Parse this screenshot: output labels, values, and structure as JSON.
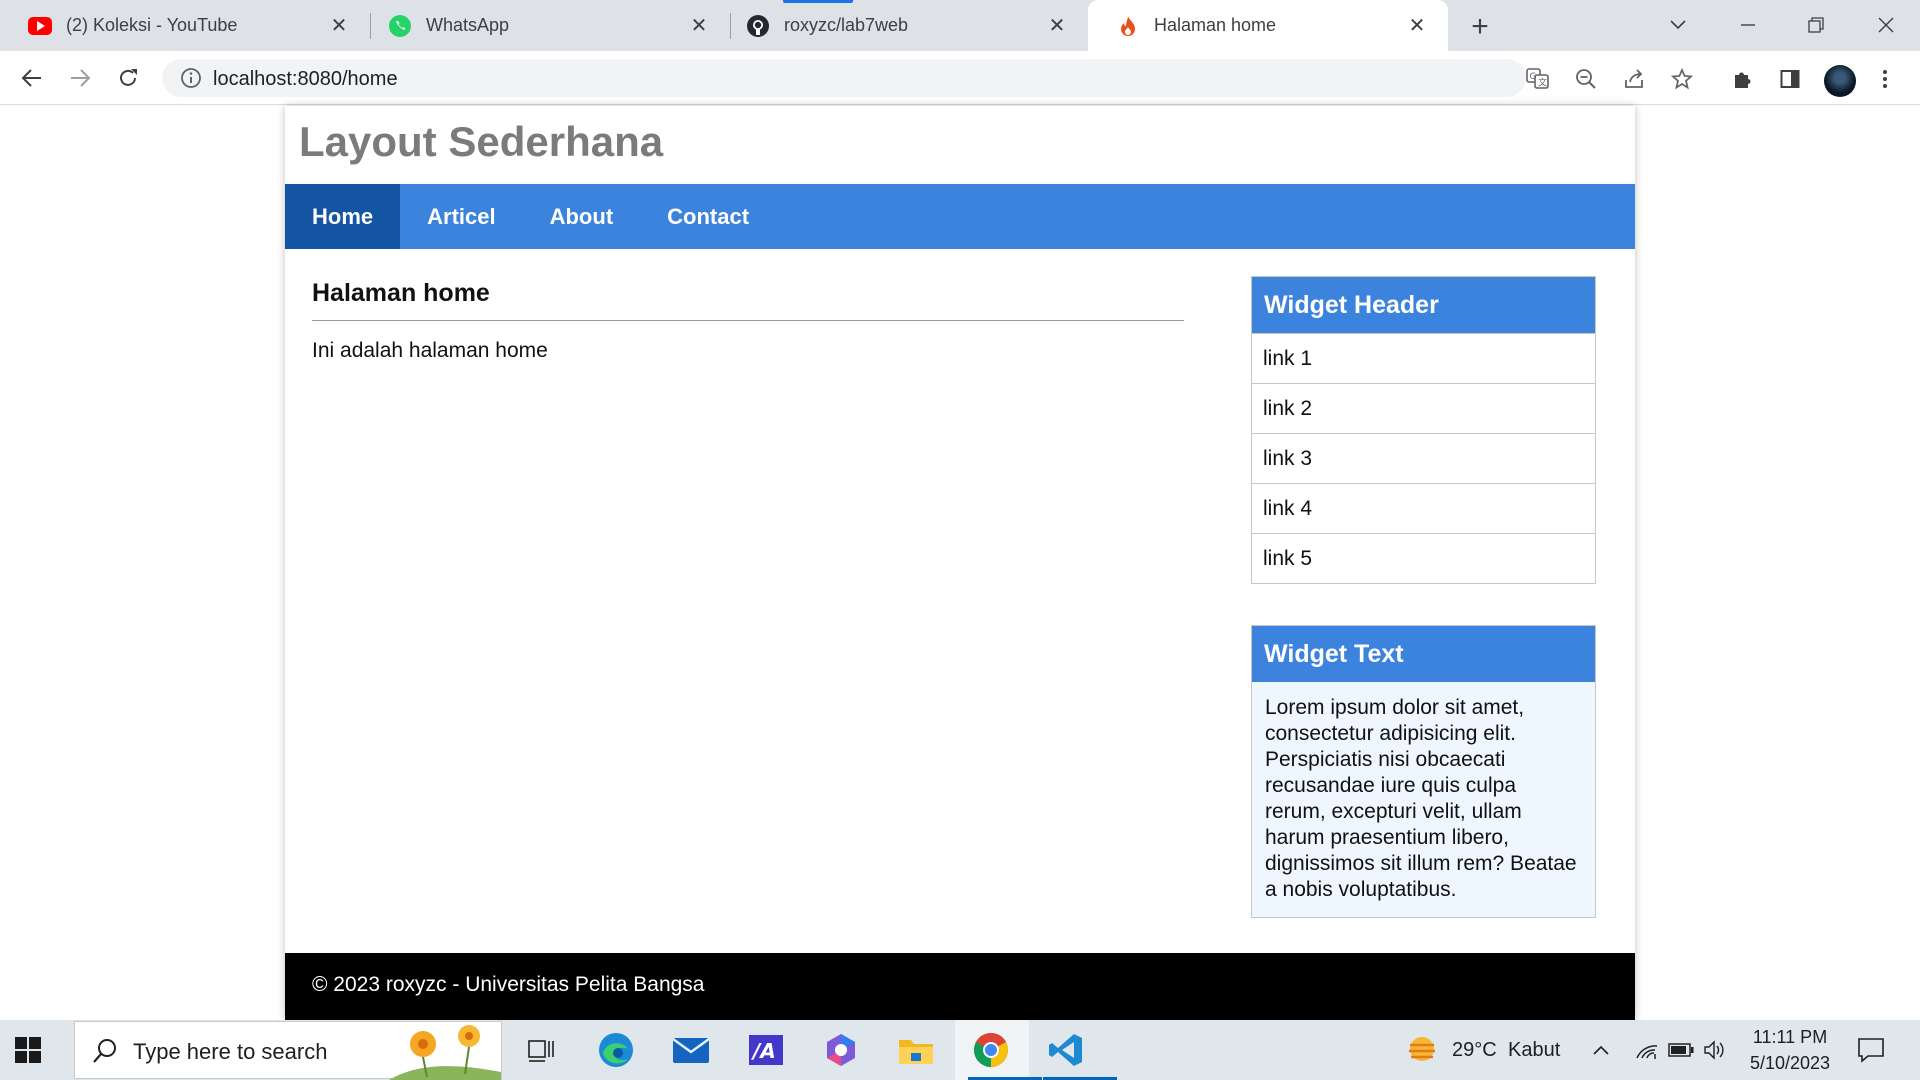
{
  "browser": {
    "tabs": [
      {
        "title": "(2) Koleksi - YouTube",
        "icon": "youtube-icon"
      },
      {
        "title": "WhatsApp",
        "icon": "whatsapp-icon"
      },
      {
        "title": "roxyzc/lab7web",
        "icon": "github-icon"
      },
      {
        "title": "Halaman home",
        "icon": "flame-icon",
        "active": true
      }
    ],
    "url": "localhost:8080/home"
  },
  "site": {
    "title": "Layout Sederhana",
    "nav": [
      {
        "label": "Home",
        "active": true
      },
      {
        "label": "Articel"
      },
      {
        "label": "About"
      },
      {
        "label": "Contact"
      }
    ],
    "content": {
      "heading": "Halaman home",
      "body": "Ini adalah halaman home"
    },
    "widget_links": {
      "header": "Widget Header",
      "links": [
        "link 1",
        "link 2",
        "link 3",
        "link 4",
        "link 5"
      ]
    },
    "widget_text": {
      "header": "Widget Text",
      "body": "Lorem ipsum dolor sit amet, consectetur adipisicing elit. Perspiciatis nisi obcaecati recusandae iure quis culpa rerum, excepturi velit, ullam harum praesentium libero, dignissimos sit illum rem? Beatae a nobis voluptatibus."
    },
    "footer": "© 2023 roxyzc - Universitas Pelita Bangsa"
  },
  "taskbar": {
    "search_placeholder": "Type here to search",
    "weather_temp": "29°C",
    "weather_desc": "Kabut",
    "time": "11:11 PM",
    "date": "5/10/2023"
  },
  "colors": {
    "nav_bg": "#3b83dd",
    "nav_active": "#1354a3",
    "title_gray": "#7b7b7b",
    "footer_bg": "#000000"
  }
}
